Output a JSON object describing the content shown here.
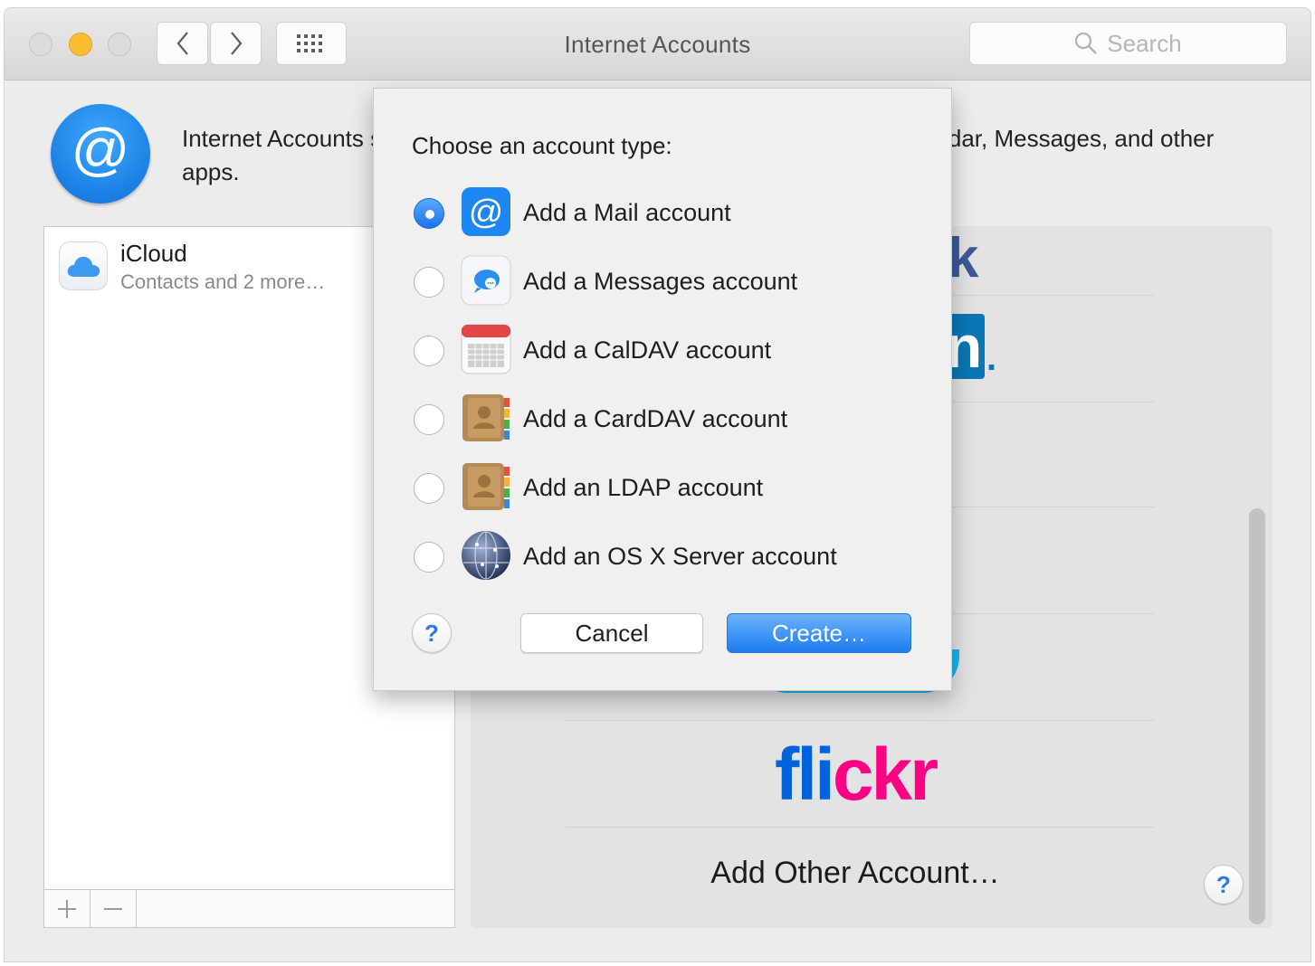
{
  "window": {
    "title": "Internet Accounts",
    "search_placeholder": "Search"
  },
  "header": {
    "description": "Internet Accounts sets up your accounts to use with Mail, Contacts, Calendar, Messages, and other apps."
  },
  "accounts": [
    {
      "name": "iCloud",
      "detail": "Contacts and 2 more…",
      "icon": "icloud-icon"
    }
  ],
  "list_toolbar": {
    "add": "+",
    "remove": "−"
  },
  "providers": {
    "flickr": [
      "fl",
      "i",
      "ckr"
    ],
    "add_other": "Add Other Account…",
    "help": "?"
  },
  "sheet": {
    "title": "Choose an account type:",
    "options": [
      {
        "label": "Add a Mail account",
        "icon": "mail-at-icon",
        "selected": true
      },
      {
        "label": "Add a Messages account",
        "icon": "messages-icon",
        "selected": false
      },
      {
        "label": "Add a CalDAV account",
        "icon": "calendar-icon",
        "selected": false
      },
      {
        "label": "Add a CardDAV account",
        "icon": "contacts-book-icon",
        "selected": false
      },
      {
        "label": "Add an LDAP account",
        "icon": "contacts-book-icon",
        "selected": false
      },
      {
        "label": "Add an OS X Server account",
        "icon": "server-globe-icon",
        "selected": false
      }
    ],
    "help": "?",
    "cancel_label": "Cancel",
    "create_label": "Create…"
  },
  "colors": {
    "accent": "#1a74e8",
    "traffic_minimize": "#fbbd2f",
    "facebook": "#3b5998",
    "linkedin": "#0a76b4",
    "vimeo": "#1ab7ea",
    "flickr_blue": "#0063dc",
    "flickr_pink": "#ff0084"
  }
}
